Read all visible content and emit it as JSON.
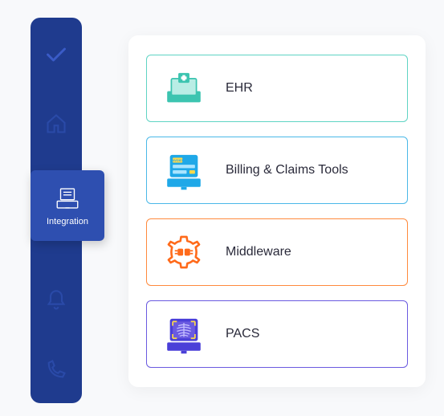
{
  "sidebar": {
    "items": [
      {
        "name": "check",
        "label": ""
      },
      {
        "name": "home",
        "label": ""
      },
      {
        "name": "integration",
        "label": "Integration"
      },
      {
        "name": "notifications",
        "label": ""
      },
      {
        "name": "phone",
        "label": ""
      }
    ]
  },
  "cards": [
    {
      "key": "ehr",
      "label": "EHR",
      "color": "#5fd4c4",
      "icon": "ehr-icon"
    },
    {
      "key": "billing",
      "label": "Billing & Claims Tools",
      "color": "#4ab8e8",
      "icon": "billing-icon"
    },
    {
      "key": "middleware",
      "label": "Middleware",
      "color": "#ff8a3d",
      "icon": "middleware-icon"
    },
    {
      "key": "pacs",
      "label": "PACS",
      "color": "#6a5ae0",
      "icon": "pacs-icon"
    }
  ]
}
